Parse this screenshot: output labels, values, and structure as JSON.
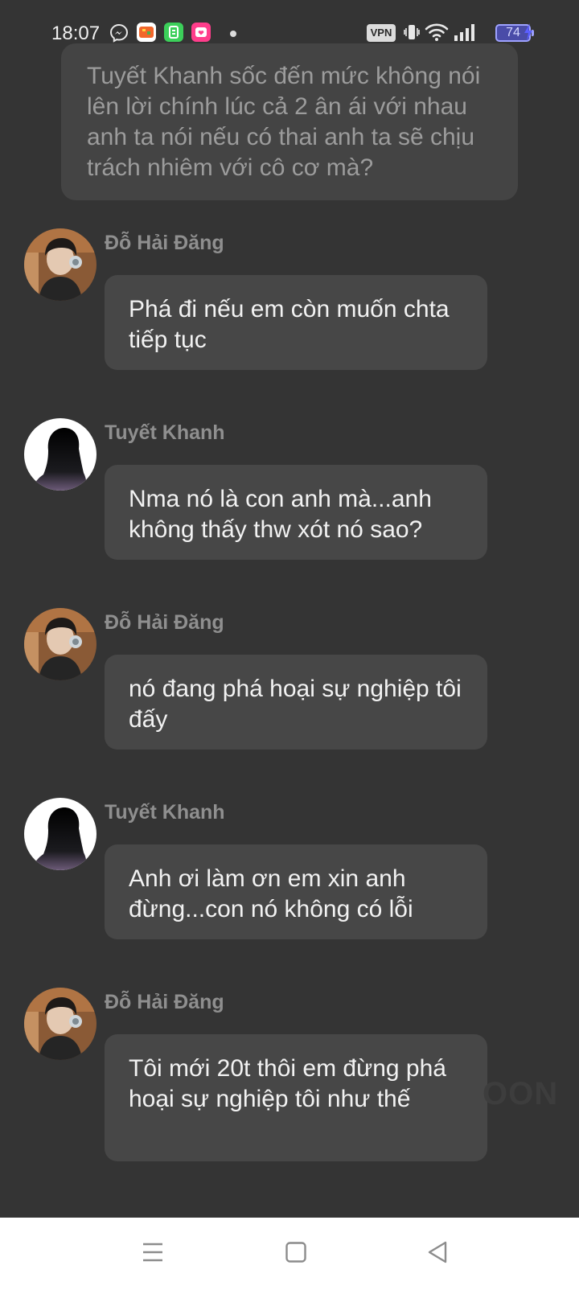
{
  "status_bar": {
    "time": "18:07",
    "notification_icons": [
      "messenger-icon",
      "game-app-icon",
      "green-app-icon",
      "love-app-icon"
    ],
    "vpn_label": "VPN",
    "battery_level": "74",
    "charging": true
  },
  "narration": {
    "text": "Tuyết Khanh sốc đến mức không nói lên lời chính lúc cả 2 ân ái với nhau anh ta nói nếu có thai anh ta sẽ chịu trách nhiêm với cô cơ mà?"
  },
  "messages": [
    {
      "sender": "Đỗ Hải Đăng",
      "text": "Phá đi nếu em còn muốn chta tiếp tục"
    },
    {
      "sender": "Tuyết Khanh",
      "text": "Nma nó là con anh mà...anh không thấy thw xót nó sao?"
    },
    {
      "sender": "Đỗ Hải Đăng",
      "text": "nó đang phá hoại sự nghiệp tôi đấy"
    },
    {
      "sender": "Tuyết Khanh",
      "text": "Anh ơi làm ơn em xin anh đừng...con nó không có lỗi"
    },
    {
      "sender": "Đỗ Hải Đăng",
      "text": "Tôi mới 20t thôi em đừng phá hoại sự nghiệp tôi như thế"
    }
  ],
  "watermark": "OON",
  "nav_bar": {
    "buttons": [
      "menu-icon",
      "home-icon",
      "back-icon"
    ]
  }
}
